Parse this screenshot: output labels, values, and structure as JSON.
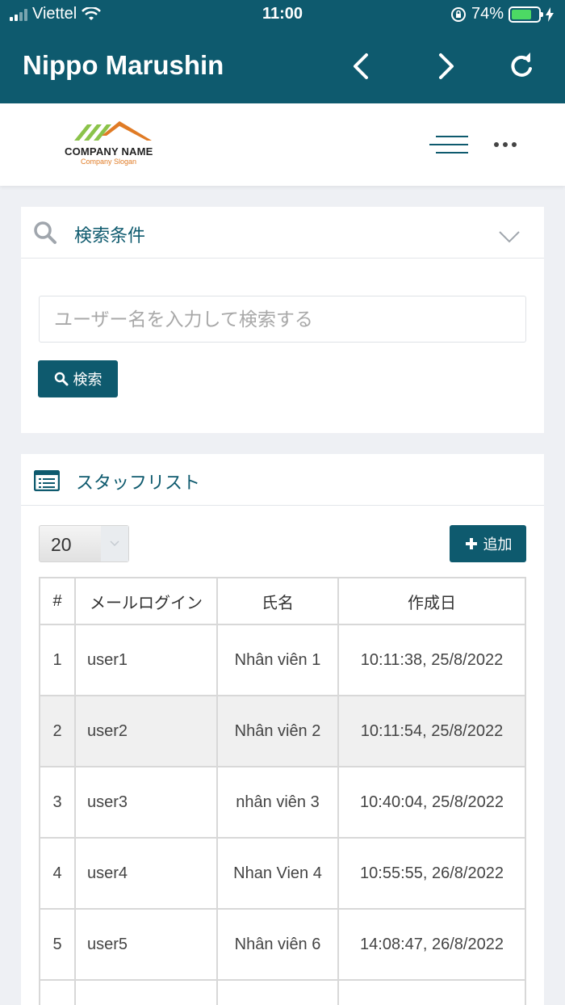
{
  "status_bar": {
    "carrier": "Viettel",
    "time": "11:00",
    "battery": "74%",
    "battery_level": 0.74
  },
  "nav": {
    "title": "Nippo Marushin",
    "back_icon": "chevron-left-icon",
    "forward_icon": "chevron-right-icon",
    "reload_icon": "reload-icon"
  },
  "brand": {
    "company_name": "COMPANY NAME",
    "slogan": "Company Slogan",
    "colors": {
      "primary": "#0e5a6e",
      "logo_green": "#8bc34a",
      "logo_orange": "#e07b25"
    }
  },
  "search_panel": {
    "title": "検索条件",
    "placeholder": "ユーザー名を入力して検索する",
    "button_label": "検索"
  },
  "staff_panel": {
    "title": "スタッフリスト",
    "page_size": "20",
    "add_label": "追加",
    "columns": [
      "#",
      "メールログイン",
      "氏名",
      "作成日"
    ],
    "rows": [
      {
        "num": "1",
        "email": "user1",
        "name": "Nhân viên 1",
        "date": "10:11:38, 25/8/2022"
      },
      {
        "num": "2",
        "email": "user2",
        "name": "Nhân viên 2",
        "date": "10:11:54, 25/8/2022"
      },
      {
        "num": "3",
        "email": "user3",
        "name": "nhân viên 3",
        "date": "10:40:04, 25/8/2022"
      },
      {
        "num": "4",
        "email": "user4",
        "name": "Nhan Vien 4",
        "date": "10:55:55, 26/8/2022"
      },
      {
        "num": "5",
        "email": "user5",
        "name": "Nhân viên 6",
        "date": "14:08:47, 26/8/2022"
      }
    ]
  }
}
